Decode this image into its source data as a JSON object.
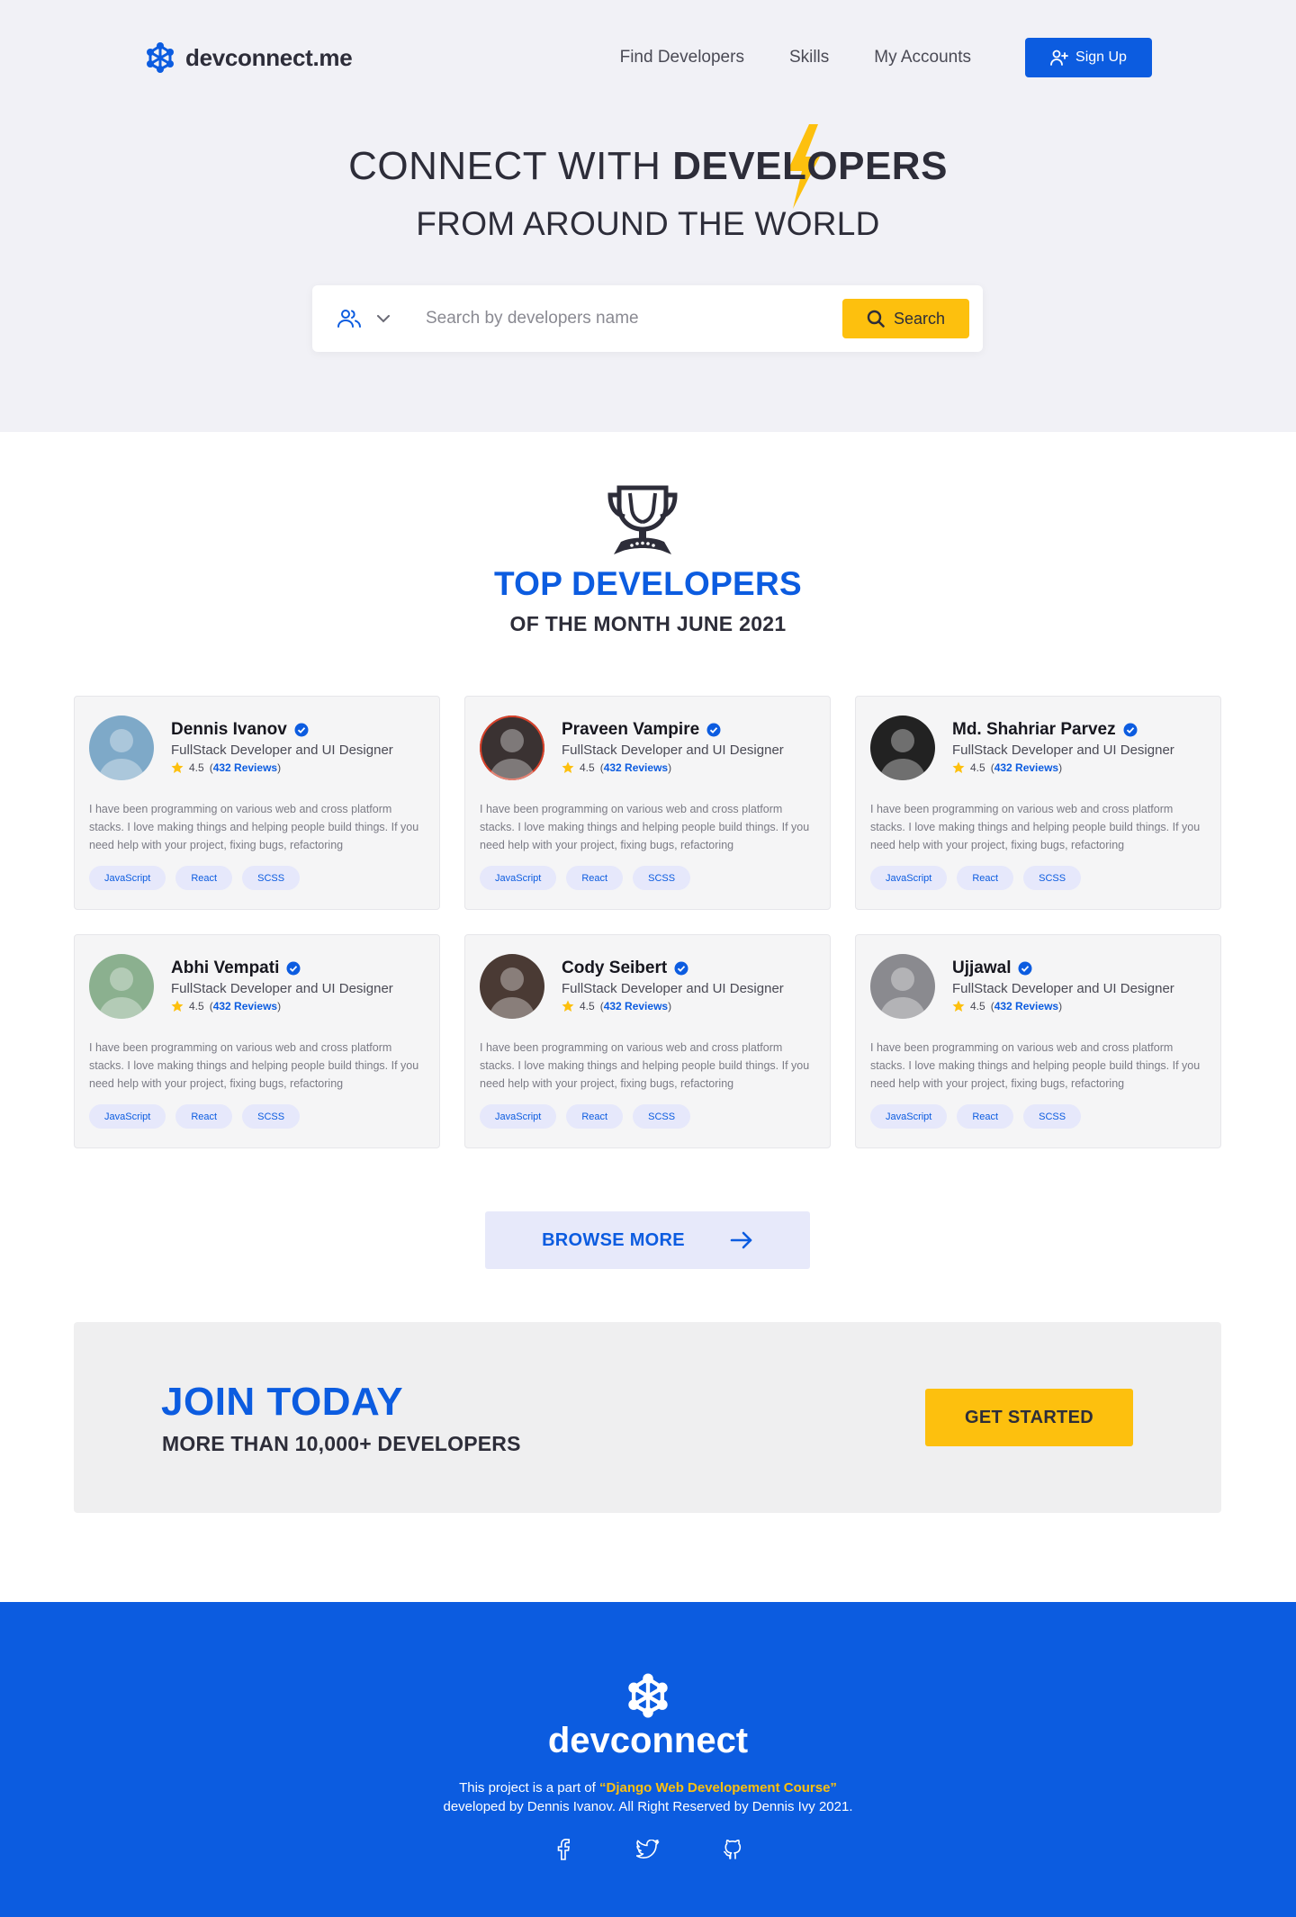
{
  "brand": {
    "name": "devconnect.me",
    "colors": {
      "primary": "#0c5ce0",
      "accent": "#fdc00e",
      "text": "#2d2d39"
    }
  },
  "nav": {
    "links": [
      "Find Developers",
      "Skills",
      "My Accounts"
    ],
    "signup_label": "Sign Up"
  },
  "hero": {
    "title_light": "CONNECT WITH ",
    "title_strong": "DEVELOPERS",
    "subtitle": "FROM AROUND THE WORLD"
  },
  "search": {
    "placeholder": "Search by developers name",
    "button_label": "Search",
    "filter_icon": "users-icon"
  },
  "top": {
    "title": "TOP DEVELOPERS",
    "subtitle": "OF THE MONTH JUNE 2021"
  },
  "developers": [
    {
      "name": "Dennis Ivanov",
      "role": "FullStack Developer and UI Designer",
      "rating": "4.5",
      "reviews": "432 Reviews",
      "bio": "I have been programming on various web and cross platform stacks. I love making things and helping people build things. If you need help with your project, fixing bugs, refactoring",
      "tags": [
        "JavaScript",
        "React",
        "SCSS"
      ],
      "avatar_color": "#7ea9c8"
    },
    {
      "name": "Praveen Vampire",
      "role": "FullStack Developer and UI Designer",
      "rating": "4.5",
      "reviews": "432 Reviews",
      "bio": "I have been programming on various web and cross platform stacks. I love making things and helping people build things. If you need help with your project, fixing bugs, refactoring",
      "tags": [
        "JavaScript",
        "React",
        "SCSS"
      ],
      "avatar_color": "#3a3232"
    },
    {
      "name": "Md. Shahriar Parvez",
      "role": "FullStack Developer and UI Designer",
      "rating": "4.5",
      "reviews": "432 Reviews",
      "bio": "I have been programming on various web and cross platform stacks. I love making things and helping people build things. If you need help with your project, fixing bugs, refactoring",
      "tags": [
        "JavaScript",
        "React",
        "SCSS"
      ],
      "avatar_color": "#222222"
    },
    {
      "name": "Abhi Vempati",
      "role": "FullStack Developer and UI Designer",
      "rating": "4.5",
      "reviews": "432 Reviews",
      "bio": "I have been programming on various web and cross platform stacks. I love making things and helping people build things. If you need help with your project, fixing bugs, refactoring",
      "tags": [
        "JavaScript",
        "React",
        "SCSS"
      ],
      "avatar_color": "#8bb08f"
    },
    {
      "name": "Cody Seibert",
      "role": "FullStack Developer and UI Designer",
      "rating": "4.5",
      "reviews": "432 Reviews",
      "bio": "I have been programming on various web and cross platform stacks. I love making things and helping people build things. If you need help with your project, fixing bugs, refactoring",
      "tags": [
        "JavaScript",
        "React",
        "SCSS"
      ],
      "avatar_color": "#4a3a34"
    },
    {
      "name": "Ujjawal",
      "role": "FullStack Developer and UI Designer",
      "rating": "4.5",
      "reviews": "432 Reviews",
      "bio": "I have been programming on various web and cross platform stacks. I love making things and helping people build things. If you need help with your project, fixing bugs, refactoring",
      "tags": [
        "JavaScript",
        "React",
        "SCSS"
      ],
      "avatar_color": "#8a8a8f"
    }
  ],
  "browse_label": "BROWSE MORE",
  "join": {
    "title": "JOIN TODAY",
    "subtitle": "MORE THAN 10,000+ DEVELOPERS",
    "button_label": "GET STARTED"
  },
  "footer": {
    "name": "devconnect",
    "text_before": "This project is a part of ",
    "course": "“Django Web Developement Course”",
    "line2": "developed by Dennis Ivanov. All Right Reserved by Dennis Ivy 2021.",
    "socials": [
      "facebook-icon",
      "twitter-icon",
      "github-icon"
    ]
  }
}
